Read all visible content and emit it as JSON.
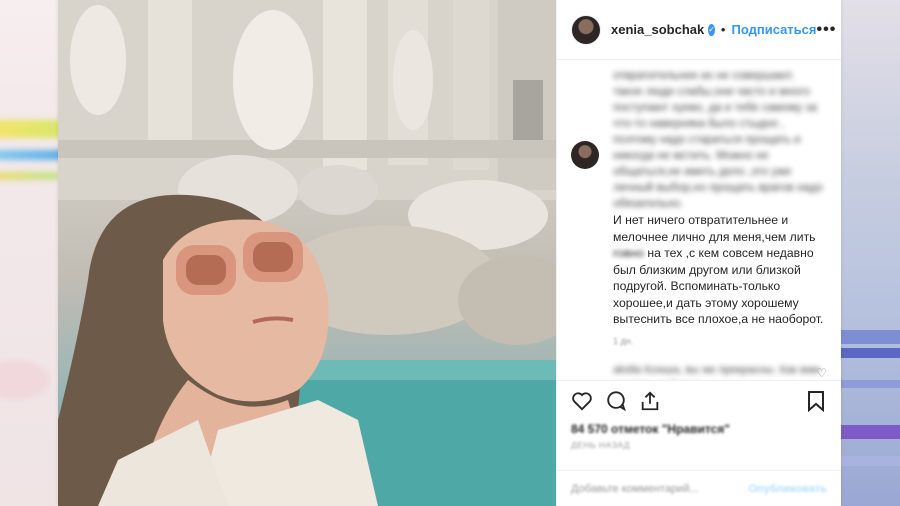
{
  "post": {
    "username": "xenia_sobchak",
    "follow_label": "Подписаться",
    "more_label": "•••",
    "caption_blurred": "отвратительнее их не совершают. такое люди слабы,они часто и много поступают хуево, да и тебе самому за что-то наверняка было стыдно , поэтому надо стараться прощать и никогда не мстить. Можно не общаться,не иметь дело ,это уже личный выбор,но прощать врагов надо обязательно.",
    "caption_clear": "И нет ничего отвратительнее и мелочнее лично для меня,чем лить",
    "caption_blurred_word": "говно",
    "caption_clear_2": "на тех ,с кем совсем недавно был близким другом или близкой подругой. Вспоминать-только хорошее,и дать этому хорошему вытеснить все плохое,а не наоборот.",
    "time_ago": "1 дн.",
    "reply_text": "akslla Ксюша, вы же прекрасны. Как вам удалось победить",
    "likes": "84 570 отметок \"Нравится\"",
    "date": "ДЕНЬ НАЗАД",
    "comment_placeholder": "Добавьте комментарий...",
    "publish_label": "Опубликовать"
  },
  "colors": {
    "accent": "#3897f0",
    "text": "#262626",
    "muted": "#999999",
    "water": "#4fa6a5"
  },
  "icons": [
    "verified-badge-icon",
    "more-options-icon",
    "heart-icon",
    "comment-icon",
    "share-icon",
    "bookmark-icon",
    "small-heart-icon"
  ]
}
